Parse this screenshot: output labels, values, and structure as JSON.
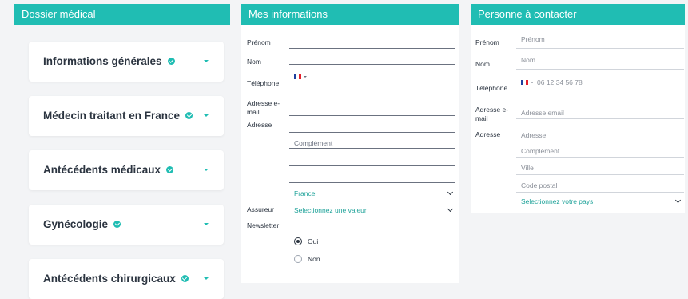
{
  "dossier": {
    "title": "Dossier médical",
    "sections": [
      "Informations générales",
      "Médecin traitant en France",
      "Antécédents médicaux",
      "Gynécologie",
      "Antécédents chirurgicaux"
    ]
  },
  "mes_infos": {
    "title": "Mes informations",
    "labels": {
      "prenom": "Prénom",
      "nom": "Nom",
      "telephone": "Téléphone",
      "email_1": "Adresse e-",
      "email_2": "mail",
      "adresse": "Adresse",
      "assureur": "Assureur",
      "newsletter": "Newsletter"
    },
    "complement_placeholder": "Complément",
    "pays_value": "France",
    "assureur_placeholder": "Selectionnez une valeur",
    "newsletter_options": [
      "Oui",
      "Non"
    ],
    "newsletter_selected": "Oui"
  },
  "contact": {
    "title": "Personne à contacter",
    "labels": {
      "prenom": "Prénom",
      "nom": "Nom",
      "telephone": "Téléphone",
      "email_1": "Adresse e-",
      "email_2": "mail",
      "adresse": "Adresse"
    },
    "placeholders": {
      "prenom": "Prénom",
      "nom": "Nom",
      "telephone": "06 12 34 56 78",
      "email": "Adresse email",
      "adresse": "Adresse",
      "complement": "Complément",
      "ville": "Ville",
      "code_postal": "Code postal",
      "pays": "Selectionnez votre pays"
    }
  },
  "colors": {
    "accent": "#20bdb3",
    "accent_text": "#20a39a",
    "flag_blue": "#1d3f9e",
    "flag_white": "#ffffff",
    "flag_red": "#e4202c"
  },
  "icons": {
    "check": "check-circle-icon",
    "caret": "caret-down-icon",
    "chevron": "chevron-down-icon",
    "flag": "flag-fr-icon"
  }
}
